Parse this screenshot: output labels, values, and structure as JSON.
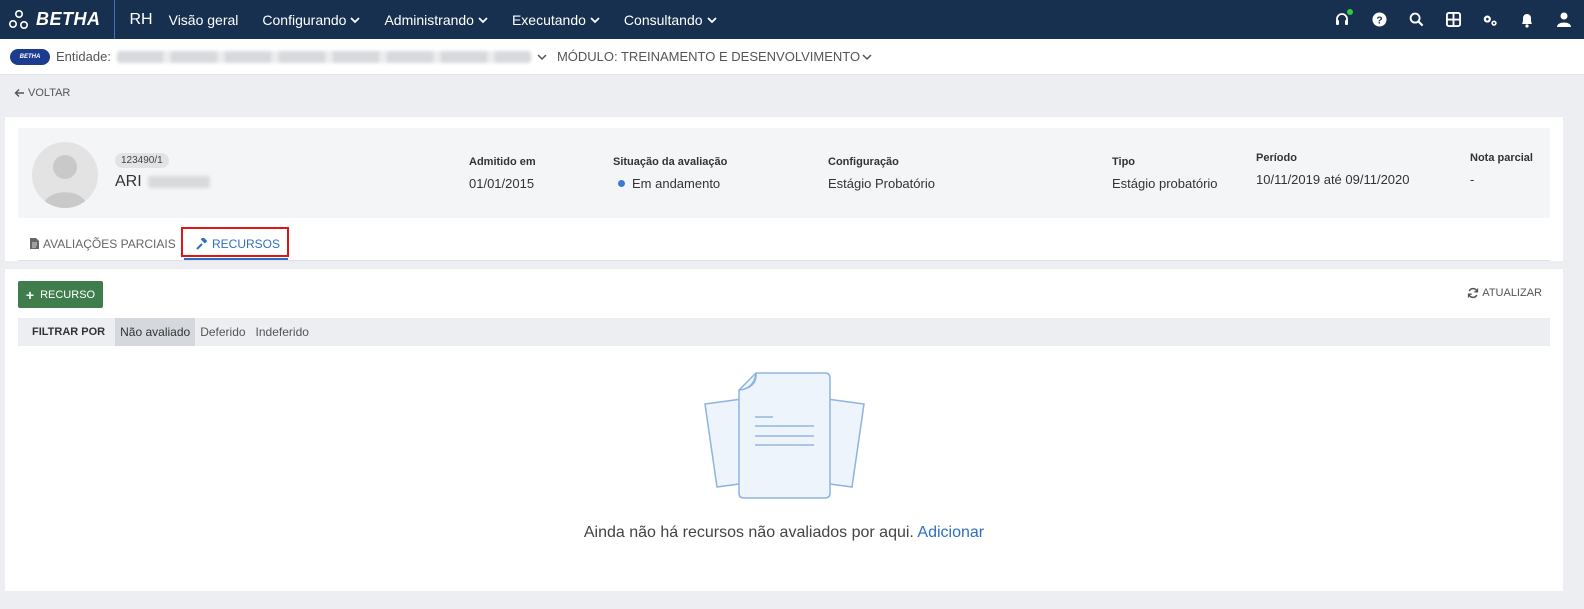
{
  "topbar": {
    "brand": "BETHA",
    "app": "RH",
    "nav": [
      {
        "label": "Visão geral",
        "dropdown": false
      },
      {
        "label": "Configurando",
        "dropdown": true
      },
      {
        "label": "Administrando",
        "dropdown": true
      },
      {
        "label": "Executando",
        "dropdown": true
      },
      {
        "label": "Consultando",
        "dropdown": true
      }
    ],
    "icons": [
      "headset-icon",
      "help-icon",
      "search-icon",
      "apps-grid-icon",
      "settings-gears-icon",
      "notifications-bell-icon",
      "user-icon"
    ]
  },
  "context": {
    "badge": "BETHA",
    "entity_label": "Entidade:",
    "module": "MÓDULO: TREINAMENTO E DESENVOLVIMENTO"
  },
  "back_label": "VOLTAR",
  "employee": {
    "code": "123490/1",
    "name": "ARI"
  },
  "info": {
    "admitted_label": "Admitido em",
    "admitted_value": "01/01/2015",
    "status_label": "Situação da avaliação",
    "status_value": "Em andamento",
    "config_label": "Configuração",
    "config_value": "Estágio Probatório",
    "type_label": "Tipo",
    "type_value": "Estágio probatório",
    "period_label": "Período",
    "period_value": "10/11/2019 até 09/11/2020",
    "grade_label": "Nota parcial",
    "grade_value": "-"
  },
  "tabs": {
    "partial": "AVALIAÇÕES PARCIAIS",
    "resources": "RECURSOS",
    "active": "RECURSOS"
  },
  "actions": {
    "add": "RECURSO",
    "refresh": "ATUALIZAR"
  },
  "filter": {
    "label": "FILTRAR POR",
    "options": [
      "Não avaliado",
      "Deferido",
      "Indeferido"
    ],
    "selected": "Não avaliado"
  },
  "empty": {
    "message": "Ainda não há recursos não avaliados por aqui.",
    "link": "Adicionar"
  },
  "colors": {
    "navbar": "#17304f",
    "accent": "#2e6fbf",
    "add_button": "#3f7d4d",
    "highlight": "#e01515"
  }
}
